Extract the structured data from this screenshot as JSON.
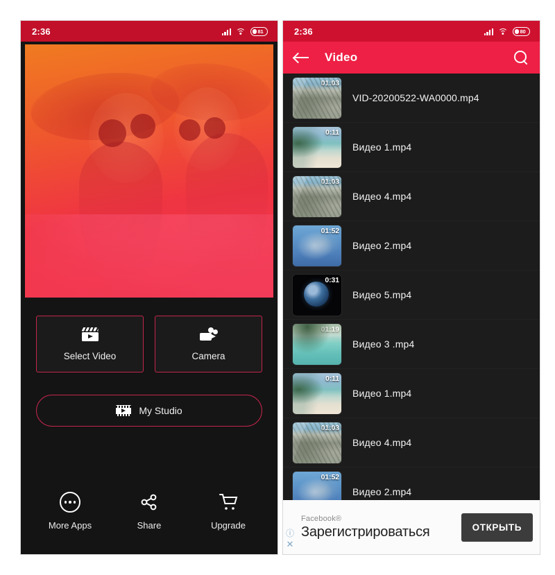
{
  "left_phone": {
    "status_bar": {
      "time": "2:36",
      "battery_level": "81",
      "signal_icon": "signal-bars-icon",
      "wifi_icon": "wifi-icon",
      "battery_icon": "battery-icon"
    },
    "hero": {
      "alt": "duotone photo of two women in sun hats and sunglasses",
      "gradient_top": "#f07b21",
      "gradient_bottom": "#f2374f"
    },
    "actions": [
      {
        "label": "Select Video",
        "icon": "clapperboard-icon"
      },
      {
        "label": "Camera",
        "icon": "video-camera-icon"
      }
    ],
    "studio": {
      "label": "My Studio",
      "icon": "film-strip-icon"
    },
    "bottom_nav": [
      {
        "label": "More Apps",
        "icon": "more-dots-icon"
      },
      {
        "label": "Share",
        "icon": "share-nodes-icon"
      },
      {
        "label": "Upgrade",
        "icon": "shopping-cart-icon"
      }
    ],
    "accent_color": "#c4264e"
  },
  "right_phone": {
    "status_bar": {
      "time": "2:36",
      "battery_level": "80",
      "signal_icon": "signal-bars-icon",
      "wifi_icon": "wifi-icon",
      "battery_icon": "battery-icon"
    },
    "app_bar": {
      "title": "Video",
      "back_icon": "back-arrow-icon",
      "search_icon": "search-icon",
      "color": "#ee2045"
    },
    "videos": [
      {
        "name": "VID-20200522-WA0000.mp4",
        "duration": "01:03",
        "thumb": "t-coastal"
      },
      {
        "name": "Видео 1.mp4",
        "duration": "0:11",
        "thumb": "t-beach"
      },
      {
        "name": "Видео 4.mp4",
        "duration": "01:03",
        "thumb": "t-coastal"
      },
      {
        "name": "Видео 2.mp4",
        "duration": "01:52",
        "thumb": "t-sea"
      },
      {
        "name": "Видео 5.mp4",
        "duration": "0:31",
        "thumb": "t-earth"
      },
      {
        "name": "Видео 3 .mp4",
        "duration": "01:19",
        "thumb": "t-lagoon"
      },
      {
        "name": "Видео 1.mp4",
        "duration": "0:11",
        "thumb": "t-beach"
      },
      {
        "name": "Видео 4.mp4",
        "duration": "01:03",
        "thumb": "t-coastal"
      },
      {
        "name": "Видео 2.mp4",
        "duration": "01:52",
        "thumb": "t-sea"
      }
    ],
    "ad": {
      "brand": "Facebook®",
      "headline": "Зарегистрироваться",
      "button_label": "ОТКРЫТЬ",
      "info_icon": "ⓘ",
      "close_icon": "✕"
    }
  }
}
